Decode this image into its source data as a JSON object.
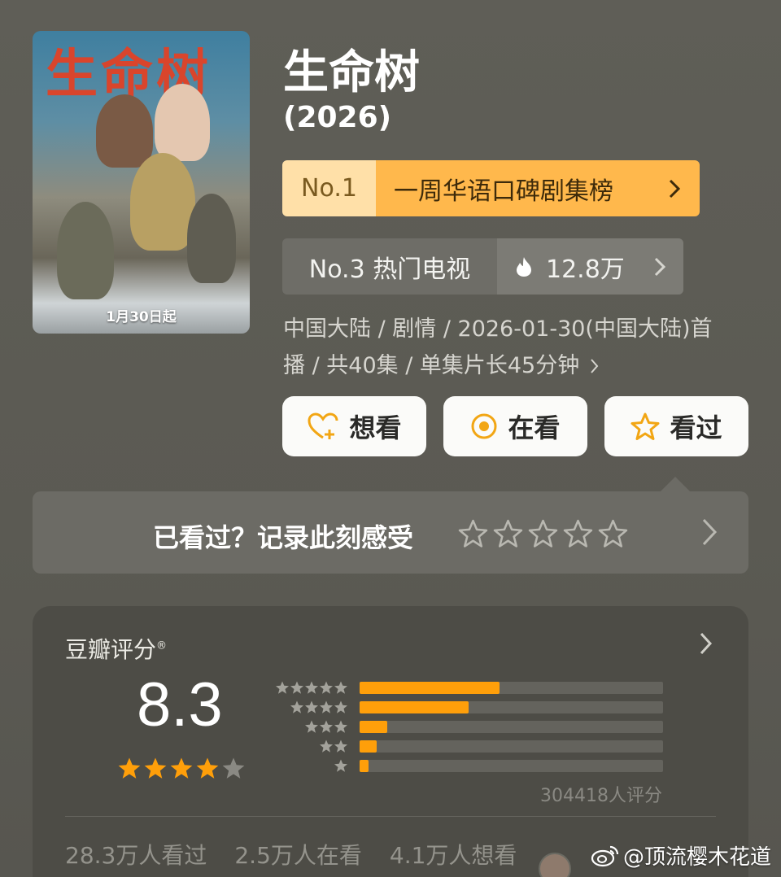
{
  "poster": {
    "title_art": "生命树",
    "date_text": "1月30日起"
  },
  "title": "生命树",
  "year": "(2026)",
  "rank_primary": {
    "no": "No.1",
    "label": "一周华语口碑剧集榜"
  },
  "rank_secondary": {
    "label": "No.3 热门电视",
    "hot_value": "12.8万"
  },
  "meta": {
    "line1": "中国大陆 / 剧情 / 2026-01-30(中国大陆)首",
    "line2": "播 / 共40集 / 单集片长45分钟"
  },
  "actions": {
    "want": "想看",
    "watching": "在看",
    "watched": "看过"
  },
  "record": {
    "prompt": "已看过？记录此刻感受",
    "star_count": 5
  },
  "rating": {
    "label": "豆瓣评分",
    "mark": "®",
    "score": "8.3",
    "stars_filled": 4,
    "distribution": [
      {
        "stars": 5,
        "fraction": 0.46
      },
      {
        "stars": 4,
        "fraction": 0.36
      },
      {
        "stars": 3,
        "fraction": 0.09
      },
      {
        "stars": 2,
        "fraction": 0.055
      },
      {
        "stars": 1,
        "fraction": 0.03
      }
    ],
    "count_text": "304418人评分"
  },
  "stats": {
    "watched": "28.3万人看过",
    "watching": "2.5万人在看",
    "want": "4.1万人想看"
  },
  "watermark": "@顶流樱木花道",
  "colors": {
    "accent": "#ff9f0a",
    "rank_gold": "#ffb84c",
    "rank_light": "#ffe0a8"
  }
}
